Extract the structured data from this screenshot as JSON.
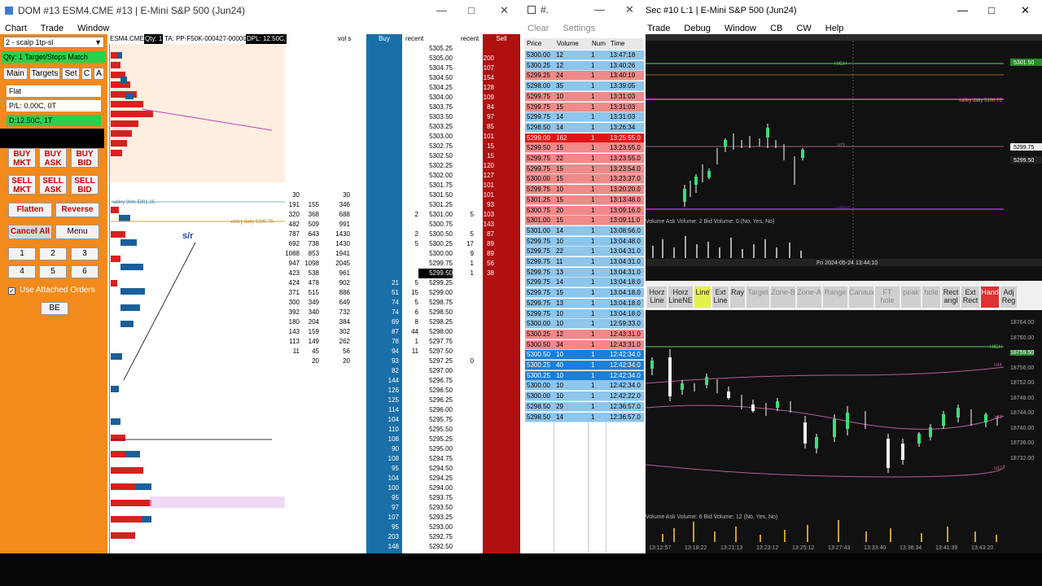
{
  "dom": {
    "title": "DOM #13 ESM4.CME #13 | E-Mini S&P 500 (Jun24)",
    "menu": [
      "Chart",
      "Trade",
      "Window"
    ],
    "account_select": "2 - scalp 1tp-sl",
    "status_qty": "Qty: 1 Target/Stops Match",
    "tabs": [
      "Main",
      "Targets",
      "Set",
      "C",
      "A"
    ],
    "position": "Flat",
    "pl": "P/L: 0.00C, 0T",
    "daily": "D:12.50C, 1T",
    "buttons": {
      "buy_mkt": "BUY MKT",
      "buy_ask": "BUY ASK",
      "buy_bid": "BUY BID",
      "sell_mkt": "SELL MKT",
      "sell_ask": "SELL ASK",
      "sell_bid": "SELL BID",
      "flatten": "Flatten",
      "reverse": "Reverse",
      "cancel_all": "Cancel All",
      "menu": "Menu",
      "be": "BE",
      "use_attached": "Use Attached Orders"
    },
    "qty_buttons": [
      "1",
      "2",
      "3",
      "4",
      "5",
      "6"
    ],
    "header": {
      "symbol": "ESM4.CME",
      "qty": "Qty: 1",
      "ta": "TA: PP-F50K-000427-000003",
      "dpl": "DPL: 12.50C,",
      "vol": "vol s",
      "buy": "Buy",
      "recent_bid": "recent",
      "recent_ask": "recent",
      "sell": "Sell"
    },
    "annotations": {
      "sr": "s/r",
      "valley_30m": "valley 30m 5301.25",
      "valley_daily": "valley daily 5300.75"
    },
    "ladder": [
      [
        "5305.25",
        "",
        "",
        "",
        "",
        "",
        "",
        ""
      ],
      [
        "5305.00",
        "",
        "",
        "",
        "",
        "",
        "",
        "200"
      ],
      [
        "5304.75",
        "",
        "",
        "",
        "",
        "",
        "",
        "107"
      ],
      [
        "5304.50",
        "",
        "",
        "",
        "",
        "",
        "",
        "154"
      ],
      [
        "5304.25",
        "",
        "",
        "",
        "",
        "",
        "",
        "128"
      ],
      [
        "5304.00",
        "",
        "",
        "",
        "",
        "",
        "",
        "109"
      ],
      [
        "5303.75",
        "",
        "",
        "",
        "",
        "",
        "",
        "84"
      ],
      [
        "5303.50",
        "",
        "",
        "",
        "",
        "",
        "",
        "97"
      ],
      [
        "5303.25",
        "",
        "",
        "",
        "",
        "",
        "",
        "85"
      ],
      [
        "5303.00",
        "",
        "",
        "",
        "",
        "",
        "",
        "101"
      ],
      [
        "5302.75",
        "",
        "",
        "",
        "",
        "",
        "",
        "15"
      ],
      [
        "5302.50",
        "",
        "",
        "",
        "",
        "",
        "",
        "15"
      ],
      [
        "5302.25",
        "",
        "",
        "",
        "",
        "",
        "",
        "120"
      ],
      [
        "5302.00",
        "",
        "",
        "",
        "",
        "",
        "",
        "127"
      ],
      [
        "5301.75",
        "",
        "",
        "",
        "",
        "",
        "",
        "101"
      ],
      [
        "5301.50",
        "30",
        "",
        "30",
        "",
        "",
        "",
        "101"
      ],
      [
        "5301.25",
        "191",
        "155",
        "346",
        "",
        "",
        "",
        "93"
      ],
      [
        "5301.00",
        "320",
        "368",
        "688",
        "",
        "2",
        "5",
        "103"
      ],
      [
        "5300.75",
        "482",
        "509",
        "991",
        "",
        "",
        "",
        "143"
      ],
      [
        "5300.50",
        "787",
        "643",
        "1430",
        "",
        "2",
        "5",
        "87"
      ],
      [
        "5300.25",
        "692",
        "738",
        "1430",
        "",
        "5",
        "17",
        "89"
      ],
      [
        "5300.00",
        "1088",
        "853",
        "1941",
        "",
        "",
        "9",
        "89"
      ],
      [
        "5299.75",
        "947",
        "1098",
        "2045",
        "",
        "",
        "1",
        "56"
      ],
      [
        "5299.50",
        "423",
        "538",
        "961",
        "",
        "",
        "1",
        "38"
      ],
      [
        "5299.25",
        "424",
        "478",
        "902",
        "21",
        "5",
        "",
        ""
      ],
      [
        "5299.00",
        "371",
        "515",
        "886",
        "51",
        "15",
        "",
        ""
      ],
      [
        "5298.75",
        "300",
        "349",
        "649",
        "74",
        "5",
        "",
        ""
      ],
      [
        "5298.50",
        "392",
        "340",
        "732",
        "74",
        "6",
        "",
        ""
      ],
      [
        "5298.25",
        "180",
        "204",
        "384",
        "69",
        "8",
        "",
        ""
      ],
      [
        "5298.00",
        "143",
        "159",
        "302",
        "87",
        "44",
        "",
        ""
      ],
      [
        "5297.75",
        "113",
        "149",
        "262",
        "78",
        "1",
        "",
        ""
      ],
      [
        "5297.50",
        "11",
        "45",
        "56",
        "94",
        "11",
        "",
        ""
      ],
      [
        "5297.25",
        "",
        "20",
        "20",
        "93",
        "",
        "0",
        ""
      ],
      [
        "5297.00",
        "",
        "",
        "",
        "82",
        "",
        "",
        ""
      ],
      [
        "5296.75",
        "",
        "",
        "",
        "144",
        "",
        "",
        ""
      ],
      [
        "5296.50",
        "",
        "",
        "",
        "126",
        "",
        "",
        ""
      ],
      [
        "5296.25",
        "",
        "",
        "",
        "125",
        "",
        "",
        ""
      ],
      [
        "5296.00",
        "",
        "",
        "",
        "114",
        "",
        "",
        ""
      ],
      [
        "5295.75",
        "",
        "",
        "",
        "104",
        "",
        "",
        ""
      ],
      [
        "5295.50",
        "",
        "",
        "",
        "110",
        "",
        "",
        ""
      ],
      [
        "5295.25",
        "",
        "",
        "",
        "108",
        "",
        "",
        ""
      ],
      [
        "5295.00",
        "",
        "",
        "",
        "90",
        "",
        "",
        ""
      ],
      [
        "5294.75",
        "",
        "",
        "",
        "108",
        "",
        "",
        ""
      ],
      [
        "5294.50",
        "",
        "",
        "",
        "95",
        "",
        "",
        ""
      ],
      [
        "5294.25",
        "",
        "",
        "",
        "104",
        "",
        "",
        ""
      ],
      [
        "5294.00",
        "",
        "",
        "",
        "100",
        "",
        "",
        ""
      ],
      [
        "5293.75",
        "",
        "",
        "",
        "95",
        "",
        "",
        ""
      ],
      [
        "5293.50",
        "",
        "",
        "",
        "97",
        "",
        "",
        ""
      ],
      [
        "5293.25",
        "",
        "",
        "",
        "107",
        "",
        "",
        ""
      ],
      [
        "5293.00",
        "",
        "",
        "",
        "95",
        "",
        "",
        ""
      ],
      [
        "5292.75",
        "",
        "",
        "",
        "203",
        "",
        "",
        ""
      ],
      [
        "5292.50",
        "",
        "",
        "",
        "148",
        "",
        "",
        ""
      ]
    ]
  },
  "ts": {
    "title": "#.",
    "menu": [
      "Clear",
      "Settings"
    ],
    "headers": [
      "Price",
      "Volume",
      "Num",
      "Time"
    ],
    "rows": [
      [
        "5300.00",
        "12",
        "1",
        "13:47:18",
        "b"
      ],
      [
        "5300.25",
        "12",
        "1",
        "13:40:26",
        "b"
      ],
      [
        "5299.25",
        "24",
        "1",
        "13:40:19",
        "s"
      ],
      [
        "5298.00",
        "35",
        "1",
        "13:39:05",
        "b"
      ],
      [
        "5299.75",
        "10",
        "1",
        "13:31:03",
        "s"
      ],
      [
        "5299.75",
        "15",
        "1",
        "13:31:03",
        "s"
      ],
      [
        "5299.75",
        "14",
        "1",
        "13:31:03",
        "b"
      ],
      [
        "5298.50",
        "14",
        "1",
        "13:26:34",
        "b"
      ],
      [
        "5299.00",
        "162",
        "1",
        "13:25:55.0",
        "r"
      ],
      [
        "5299.50",
        "15",
        "1",
        "13:23:55.0",
        "s"
      ],
      [
        "5299.75",
        "22",
        "1",
        "13:23:55.0",
        "s"
      ],
      [
        "5299.75",
        "15",
        "1",
        "13:23:54.0",
        "s"
      ],
      [
        "5300.00",
        "15",
        "1",
        "13:23:37.0",
        "s"
      ],
      [
        "5299.75",
        "10",
        "1",
        "13:20:20.0",
        "s"
      ],
      [
        "5301.25",
        "15",
        "1",
        "13:13:48.0",
        "s"
      ],
      [
        "5300.75",
        "20",
        "1",
        "13:09:16.0",
        "s"
      ],
      [
        "5301.00",
        "15",
        "1",
        "13:09:11.0",
        "s"
      ],
      [
        "5301.00",
        "14",
        "1",
        "13:08:56.0",
        "b"
      ],
      [
        "5299.75",
        "10",
        "1",
        "13:04:48.0",
        "b"
      ],
      [
        "5299.75",
        "22",
        "1",
        "13:04:31.0",
        "b"
      ],
      [
        "5299.75",
        "11",
        "1",
        "13:04:31.0",
        "b"
      ],
      [
        "5299.75",
        "13",
        "1",
        "13:04:31.0",
        "b"
      ],
      [
        "5299.75",
        "14",
        "1",
        "13:04:18.0",
        "b"
      ],
      [
        "5299.75",
        "15",
        "1",
        "13:04:18.0",
        "b"
      ],
      [
        "5299.75",
        "13",
        "1",
        "13:04:18.0",
        "b"
      ],
      [
        "5299.75",
        "10",
        "1",
        "13:04:18.0",
        "b"
      ],
      [
        "5300.00",
        "10",
        "1",
        "12:59:33.0",
        "b"
      ],
      [
        "5300.25",
        "12",
        "1",
        "12:43:31.0",
        "s"
      ],
      [
        "5300.50",
        "34",
        "1",
        "12:43:31.0",
        "s"
      ],
      [
        "5300.50",
        "10",
        "1",
        "12:42:34.0",
        "d"
      ],
      [
        "5300.25",
        "40",
        "1",
        "12:42:34.0",
        "d"
      ],
      [
        "5300.25",
        "10",
        "1",
        "12:42:34.0",
        "d"
      ],
      [
        "5300.00",
        "10",
        "1",
        "12:42:34.0",
        "b"
      ],
      [
        "5300.00",
        "10",
        "1",
        "12:42:22.0",
        "b"
      ],
      [
        "5298.50",
        "29",
        "1",
        "12:36:57.0",
        "b"
      ],
      [
        "5298.50",
        "14",
        "1",
        "12:36:57.0",
        "b"
      ]
    ]
  },
  "chart": {
    "title": "Sec #10 L:1 | E-Mini S&P 500 (Jun24)",
    "menu": [
      "Trade",
      "Debug",
      "Window",
      "CB",
      "CW",
      "Help"
    ],
    "top_labels": {
      "high": "HIGH",
      "valley_daily": "valley daily 5300.75",
      "sd3": "sd3",
      "vpoc": "VPOC"
    },
    "top_prices": [
      "5301.50",
      "5299.75",
      "5299.50"
    ],
    "subgraph1": "Volume Ask Volume: 2 Bid Volume: 0 (No, Yes, No)",
    "subgraph2": "Volume Ask Volume: 6 Bid Volume: 12 (No, Yes, No)",
    "time_label_top": "Fri 2024-05-24 13:44:10",
    "draw_tools": [
      "Horz Line",
      "Horz LineNE",
      "Line",
      "Ext Line",
      "Ray",
      "Target",
      "Zone-B",
      "Zone-A",
      "Range",
      "Canaux",
      "FT hole",
      "peak",
      "hole",
      "Rect angl",
      "Ext Rect",
      "Hand",
      "Adj Reg"
    ],
    "bottom_prices": [
      "18764.00",
      "18760.00",
      "18759.50",
      "18756.00",
      "18752.00",
      "18748.00",
      "18744.00",
      "18740.00",
      "18736.00",
      "18732.00"
    ],
    "bottom_labels": {
      "high": "HIGH",
      "sd4": "sd4",
      "sd3": "sd3",
      "sd2": "sd2"
    },
    "bottom_times": [
      "13:12:57",
      "13:18:22",
      "13:21:13",
      "13:23:12",
      "13:25:12",
      "13:27:43",
      "13:33:40",
      "13:36:34",
      "13:41:39",
      "13:43:20"
    ]
  },
  "colors": {
    "orange": "#f28a1c",
    "buy_col": "#1a6fa8",
    "sell_col": "#b01010",
    "profile_red": "#d62020",
    "profile_blue": "#1a5f9a"
  }
}
